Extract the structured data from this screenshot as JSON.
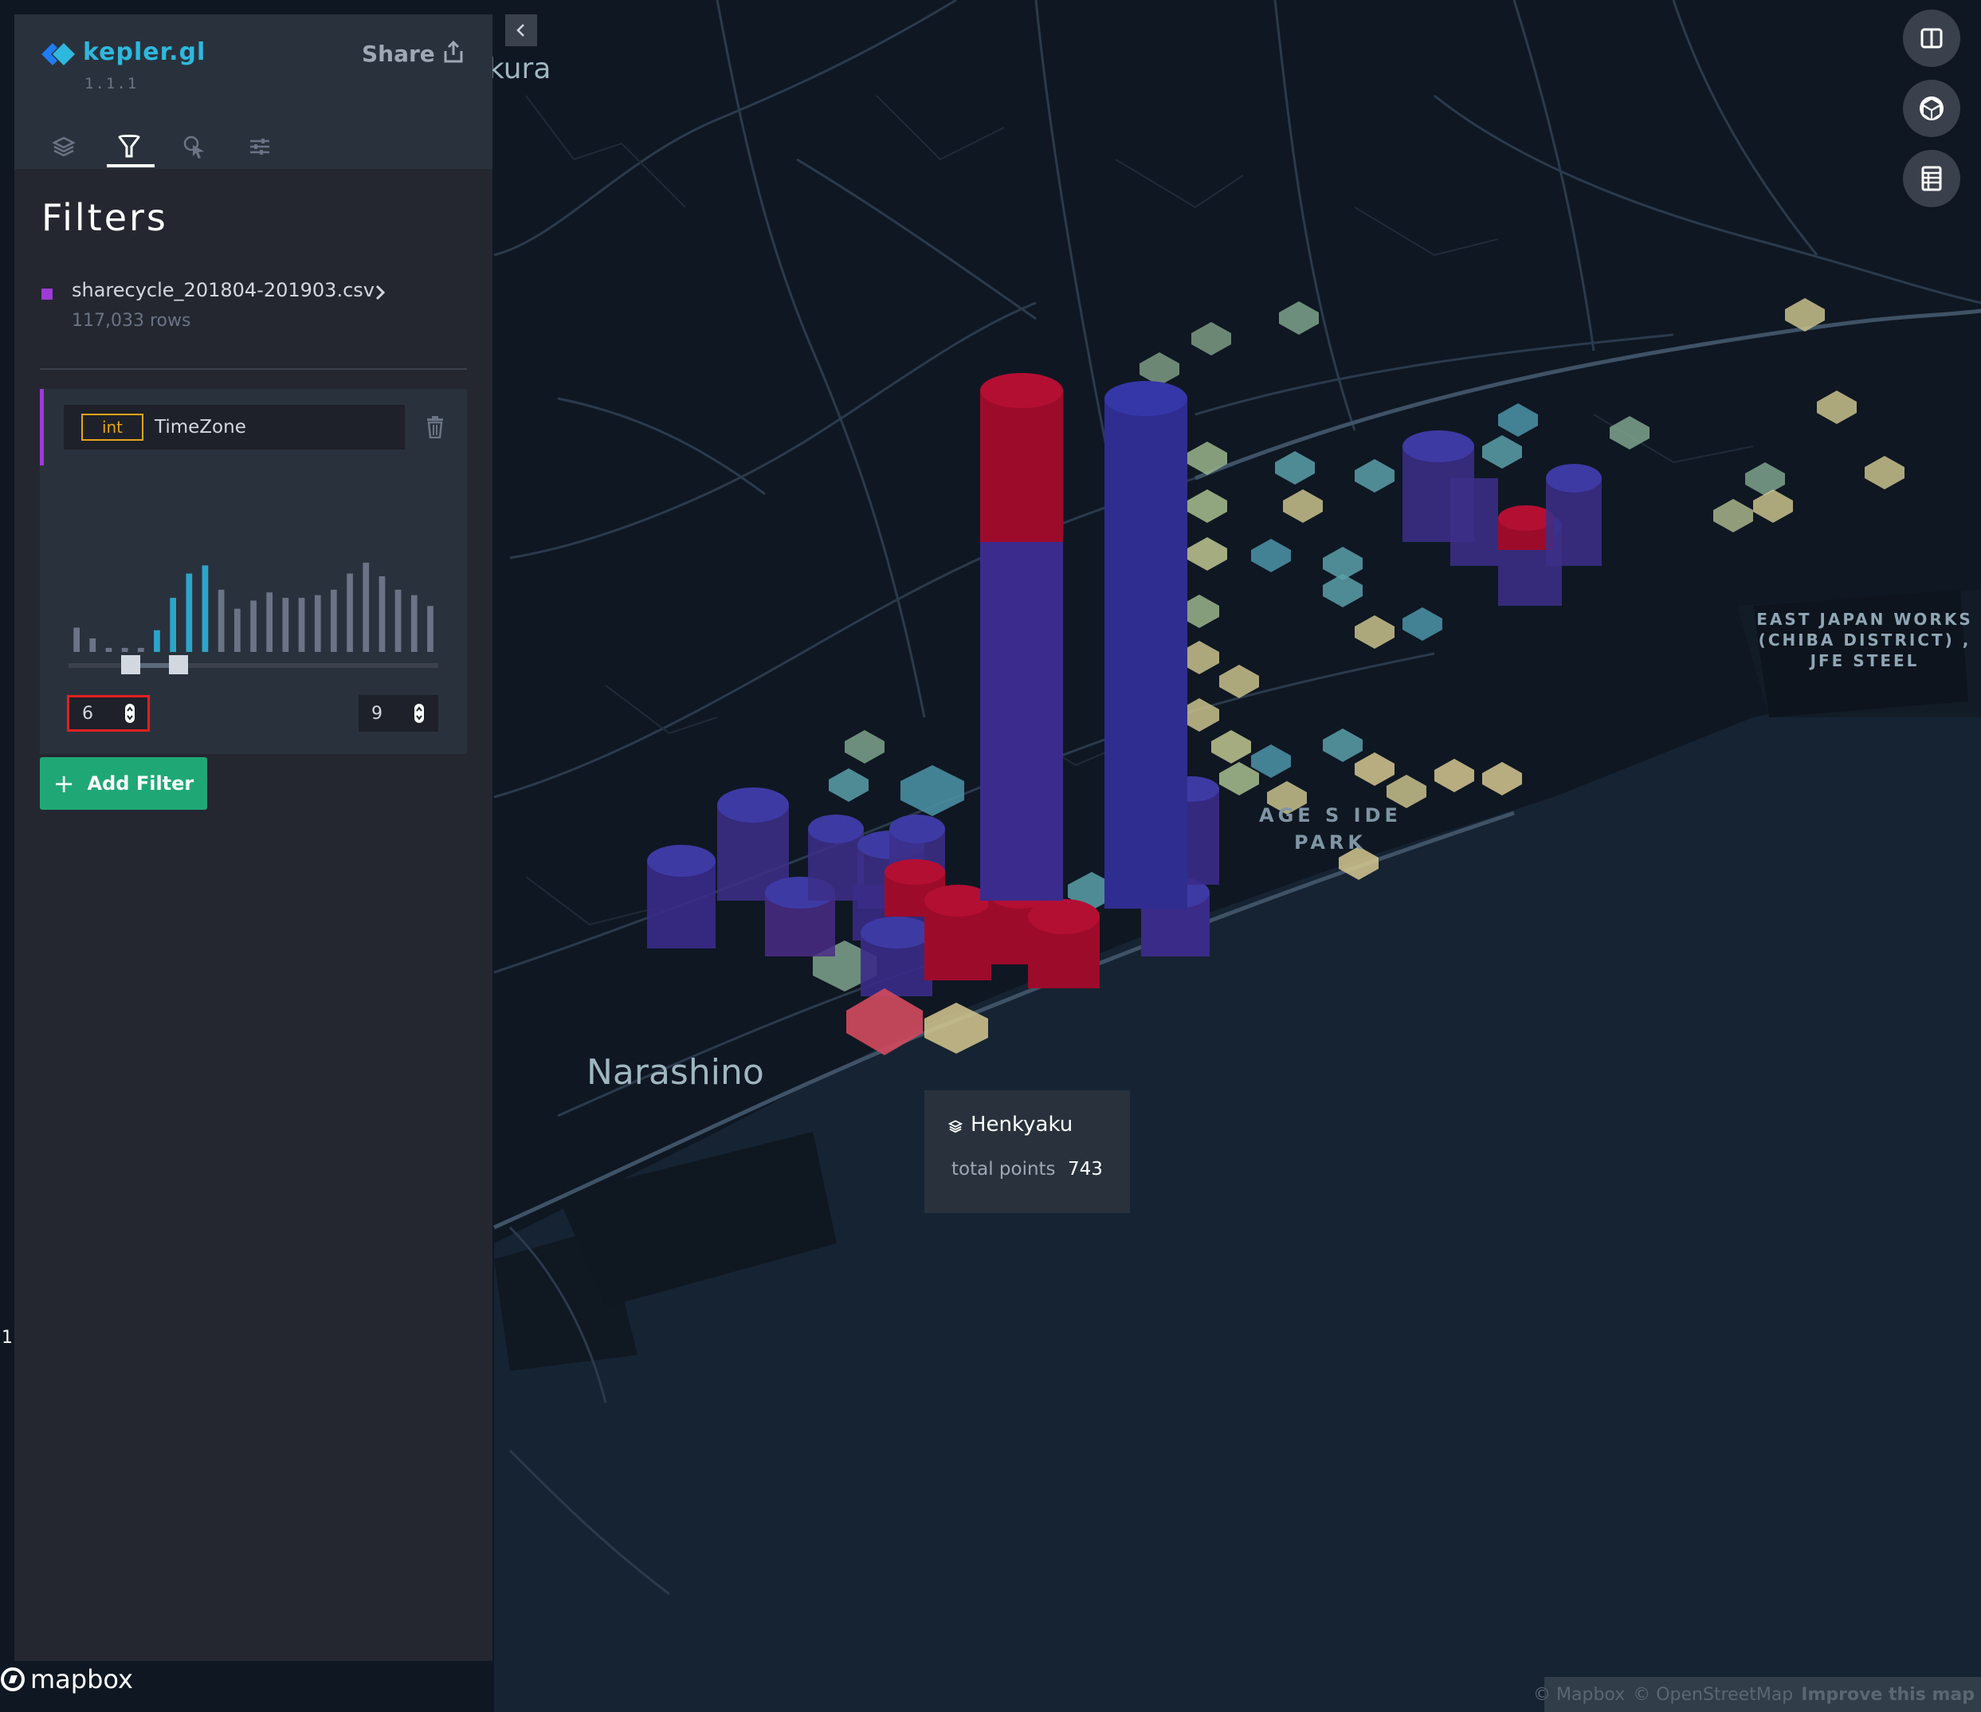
{
  "app": {
    "name": "kepler.gl",
    "version": "1.1.1",
    "share_label": "Share"
  },
  "tabs": [
    {
      "name": "layers",
      "icon": "layers-icon",
      "active": false
    },
    {
      "name": "filters",
      "icon": "filter-icon",
      "active": true
    },
    {
      "name": "interactions",
      "icon": "cursor-icon",
      "active": false
    },
    {
      "name": "map-settings",
      "icon": "sliders-icon",
      "active": false
    }
  ],
  "panel": {
    "title": "Filters",
    "dataset": {
      "name": "sharecycle_201804-201903.csv",
      "rows": "117,033 rows",
      "color": "#9d3ad8"
    },
    "filter": {
      "field_type": "int",
      "field_name": "TimeZone",
      "range_min": "6",
      "range_max": "9",
      "accent_color": "#9d3ad8",
      "histogram": [
        18,
        10,
        3,
        3,
        3,
        16,
        40,
        58,
        64,
        46,
        32,
        38,
        44,
        40,
        40,
        42,
        46,
        58,
        66,
        56,
        46,
        42,
        34
      ],
      "selected_bins": [
        5,
        6,
        7,
        8
      ]
    },
    "add_filter_label": "Add Filter"
  },
  "map": {
    "labels": {
      "narashino": "Narashino",
      "kura": "kura",
      "jfe": "EAST JAPAN WORKS (CHIBA DISTRICT) , JFE STEEL",
      "park_line1": "AGE S   IDE",
      "park_line2": "PARK"
    },
    "controls": [
      "split-map-icon",
      "3d-cube-icon",
      "legend-icon"
    ]
  },
  "tooltip": {
    "layer_name": "Henkyaku",
    "metric_label": "total points",
    "metric_value": "743"
  },
  "attribution": {
    "mapbox": "© Mapbox",
    "osm": "© OpenStreetMap",
    "improve": "Improve this map",
    "logo": "mapbox"
  },
  "stray_digit": "1",
  "colors": {
    "accent": "#2fb8de",
    "add_filter": "#1fa876",
    "error_border": "#e02020",
    "type_badge": "#e8a317"
  }
}
